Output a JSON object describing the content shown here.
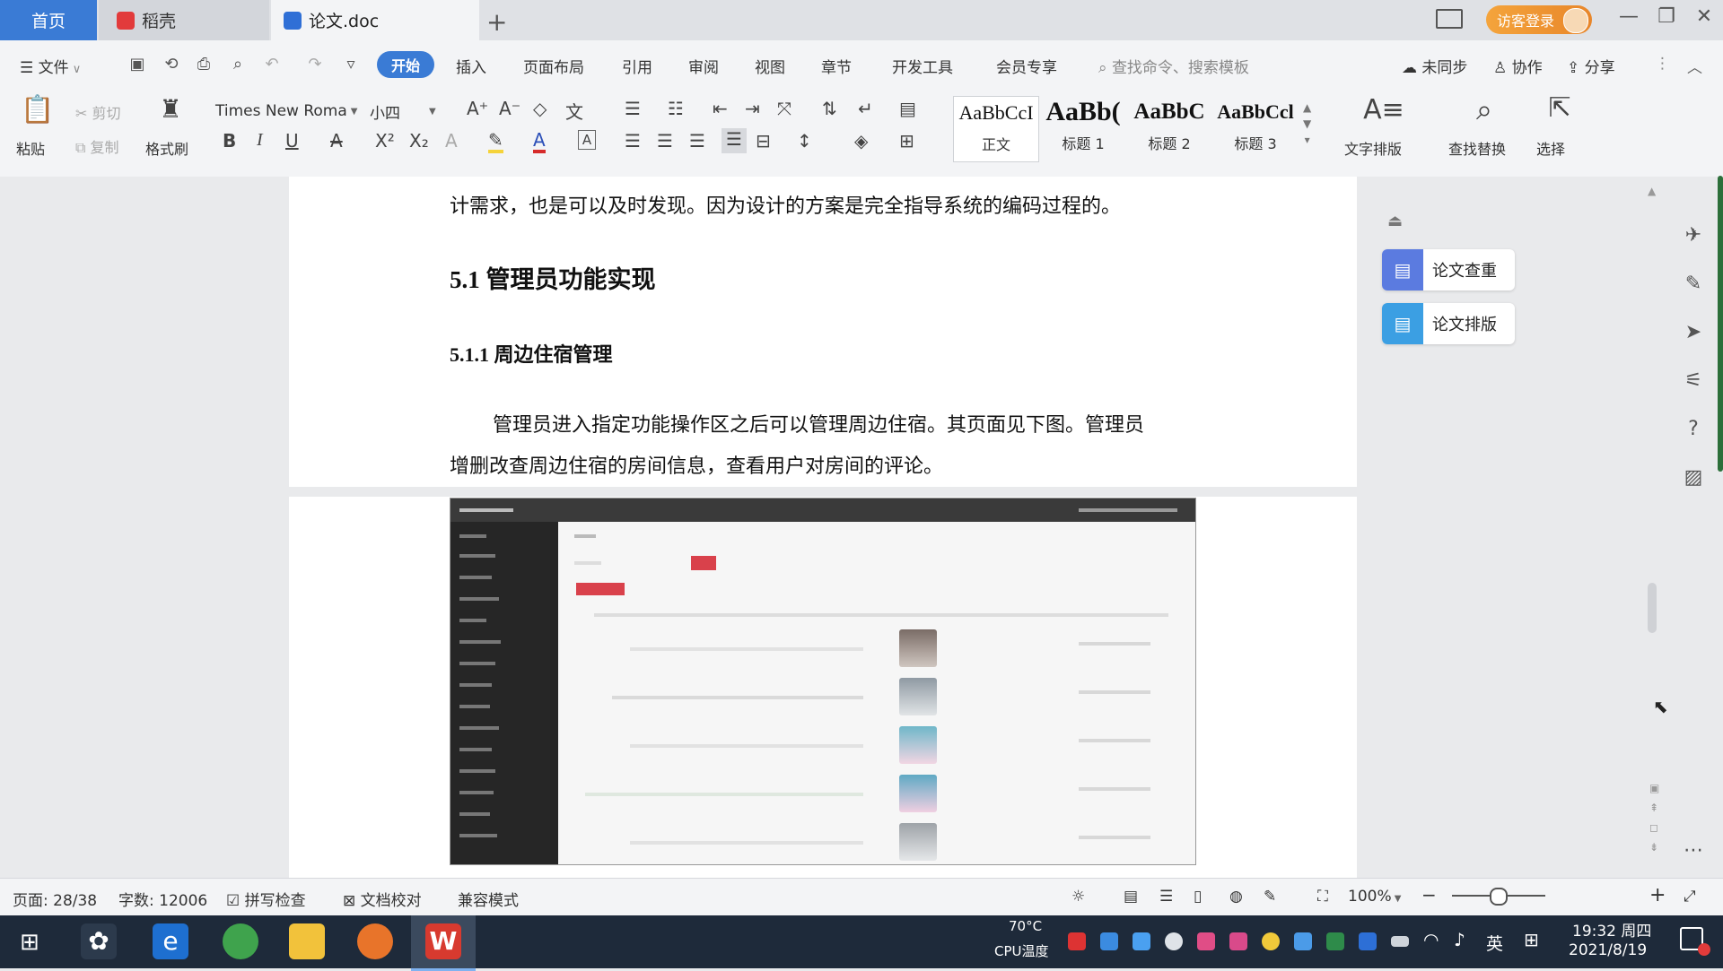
{
  "tabs": {
    "home": "首页",
    "daoke": "稻壳",
    "doc": "论文.doc",
    "new_tab": "+"
  },
  "titlebar": {
    "login": "访客登录",
    "min": "—",
    "restore": "❐",
    "close": "✕"
  },
  "menubar": {
    "file": "文件",
    "start": "开始",
    "insert": "插入",
    "page_layout": "页面布局",
    "references": "引用",
    "review": "审阅",
    "view": "视图",
    "chapter": "章节",
    "dev_tools": "开发工具",
    "member": "会员专享",
    "search_placeholder": "查找命令、搜索模板",
    "unsynced": "未同步",
    "collab": "协作",
    "share": "分享"
  },
  "ribbon": {
    "paste": "粘贴",
    "cut": "剪切",
    "copy": "复制",
    "format_painter": "格式刷",
    "font_name": "Times New Roma",
    "font_size": "小四",
    "styles": [
      {
        "sample": "AaBbCcI",
        "name": "正文"
      },
      {
        "sample": "AaBb(",
        "name": "标题 1"
      },
      {
        "sample": "AaBbC",
        "name": "标题 2"
      },
      {
        "sample": "AaBbCcl",
        "name": "标题 3"
      }
    ],
    "text_layout": "文字排版",
    "find_replace": "查找替换",
    "select": "选择"
  },
  "document": {
    "para_top": "计需求，也是可以及时发现。因为设计的方案是完全指导系统的编码过程的。",
    "heading_51": "5.1  管理员功能实现",
    "heading_511": "5.1.1  周边住宿管理",
    "para_1": "管理员进入指定功能操作区之后可以管理周边住宿。其页面见下图。管理员",
    "para_2": "增删改查周边住宿的房间信息，查看用户对房间的评论。"
  },
  "sidepanel": {
    "check": "论文查重",
    "layout": "论文排版"
  },
  "statusbar": {
    "page": "页面: 28/38",
    "words": "字数: 12006",
    "spell": "拼写检查",
    "proof": "文档校对",
    "compat": "兼容模式",
    "zoom": "100%",
    "zoom_level": 0.5
  },
  "taskbar": {
    "temp": "70°C",
    "cpu": "CPU温度",
    "ime": "英",
    "time": "19:32 周四",
    "date": "2021/8/19"
  },
  "colors": {
    "accent": "#3a7bd5",
    "login": "#e8862a"
  }
}
